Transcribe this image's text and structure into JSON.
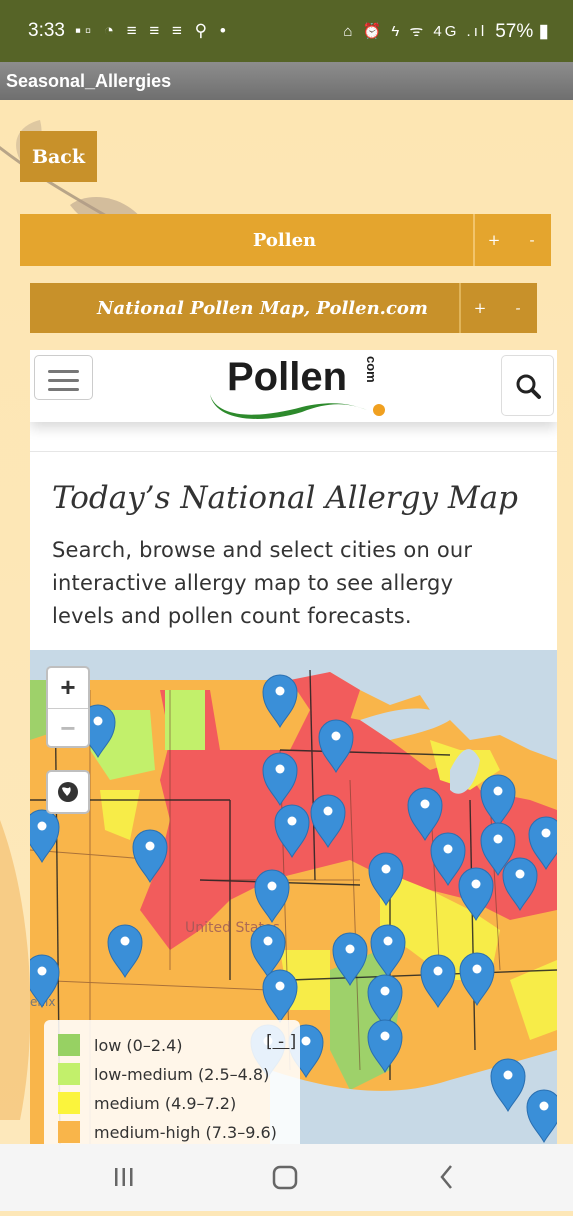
{
  "status_bar": {
    "time": "3:33",
    "left_icons": "▪▫ ◔ ≡ ≡ ≡ ⚲ •",
    "right_icons": "⌂ ⏰ ϟ ᯤ 4G .ıl",
    "battery": "57%"
  },
  "app": {
    "title": "Seasonal_Allergies"
  },
  "back_button": {
    "label": "Back"
  },
  "accordion_pollen": {
    "label": "Pollen",
    "plus": "+",
    "minus": "-"
  },
  "accordion_map": {
    "label": "National Pollen Map, Pollen.com",
    "plus": "+",
    "minus": "-"
  },
  "site": {
    "logo_text": "Pollen",
    "logo_suffix": "com",
    "heading": "Today’s National Allergy Map",
    "description": "Search, browse and select cities on our interactive allergy map to see allergy levels and pollen count forecasts."
  },
  "map": {
    "zoom_in": "+",
    "zoom_out": "−",
    "place_label": "United States",
    "place_label_2": "enix",
    "legend": {
      "collapse_label": "[ - ]",
      "items": [
        {
          "label": "low (0–2.4)",
          "color": "#97d163"
        },
        {
          "label": "low-medium (2.5–4.8)",
          "color": "#c2f06b"
        },
        {
          "label": "medium (4.9–7.2)",
          "color": "#fbf43c"
        },
        {
          "label": "medium-high (7.3–9.6)",
          "color": "#f9b54a"
        }
      ]
    },
    "colors": {
      "high": "#f25c5c",
      "medium_high": "#f9b54a",
      "medium": "#f7ec48",
      "low": "#9ed16a",
      "water": "#c7d9e6",
      "marker": "#3a8fd8"
    }
  }
}
